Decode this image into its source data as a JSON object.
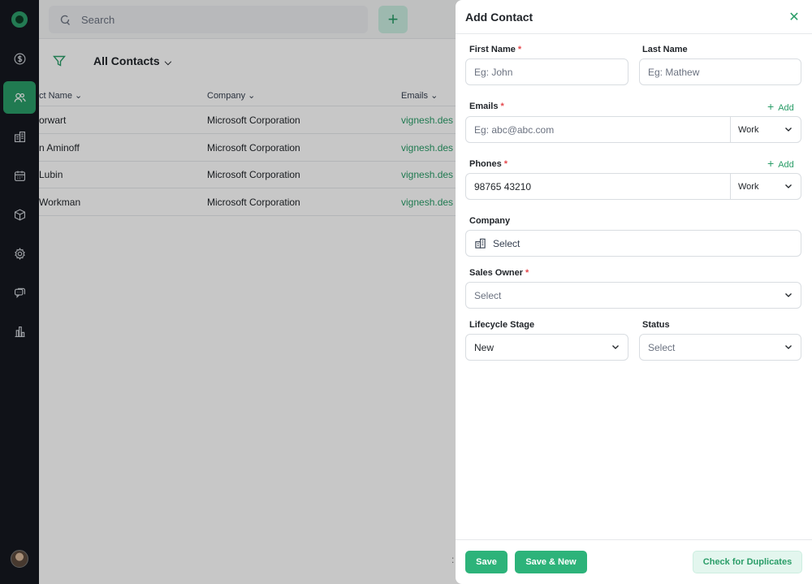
{
  "sidebar": {
    "items": [
      {
        "icon": "deals-dollar-icon"
      },
      {
        "icon": "contacts-icon",
        "active": true
      },
      {
        "icon": "accounts-building-icon"
      },
      {
        "icon": "calendar-icon"
      },
      {
        "icon": "products-box-icon"
      },
      {
        "icon": "settings-gear-icon"
      },
      {
        "icon": "chat-icon"
      },
      {
        "icon": "reports-chart-icon"
      }
    ]
  },
  "topbar": {
    "search_placeholder": "Search",
    "add_label": "+"
  },
  "list": {
    "view_title": "All Contacts",
    "columns": [
      "ct Name",
      "Company",
      "Emails"
    ],
    "rows": [
      {
        "name": "orwart",
        "company": "Microsoft Corporation",
        "email": "vignesh.des"
      },
      {
        "name": "n Aminoff",
        "company": "Microsoft Corporation",
        "email": "vignesh.des"
      },
      {
        "name": "Lubin",
        "company": "Microsoft Corporation",
        "email": "vignesh.des"
      },
      {
        "name": "Workman",
        "company": "Microsoft Corporation",
        "email": "vignesh.des"
      }
    ]
  },
  "drawer": {
    "title": "Add Contact",
    "first_name": {
      "label": "First Name",
      "required": "*",
      "placeholder": "Eg: John"
    },
    "last_name": {
      "label": "Last Name",
      "placeholder": "Eg:  Mathew"
    },
    "emails": {
      "label": "Emails",
      "required": "*",
      "add": "Add",
      "placeholder": "Eg: abc@abc.com",
      "type": "Work"
    },
    "phones": {
      "label": "Phones",
      "required": "*",
      "add": "Add",
      "value": "98765 43210",
      "type": "Work"
    },
    "company": {
      "label": "Company",
      "placeholder": "Select"
    },
    "sales_owner": {
      "label": "Sales Owner",
      "required": "*",
      "placeholder": "Select"
    },
    "lifecycle": {
      "label": "Lifecycle Stage",
      "value": "New"
    },
    "status": {
      "label": "Status",
      "placeholder": "Select"
    },
    "footer": {
      "save": "Save",
      "save_new": "Save & New",
      "check_duplicates": "Check for Duplicates",
      "scroll_indicator": ":"
    }
  },
  "colors": {
    "accent": "#2db37a",
    "sidebar_bg": "#15181f",
    "required": "#e5484d"
  }
}
